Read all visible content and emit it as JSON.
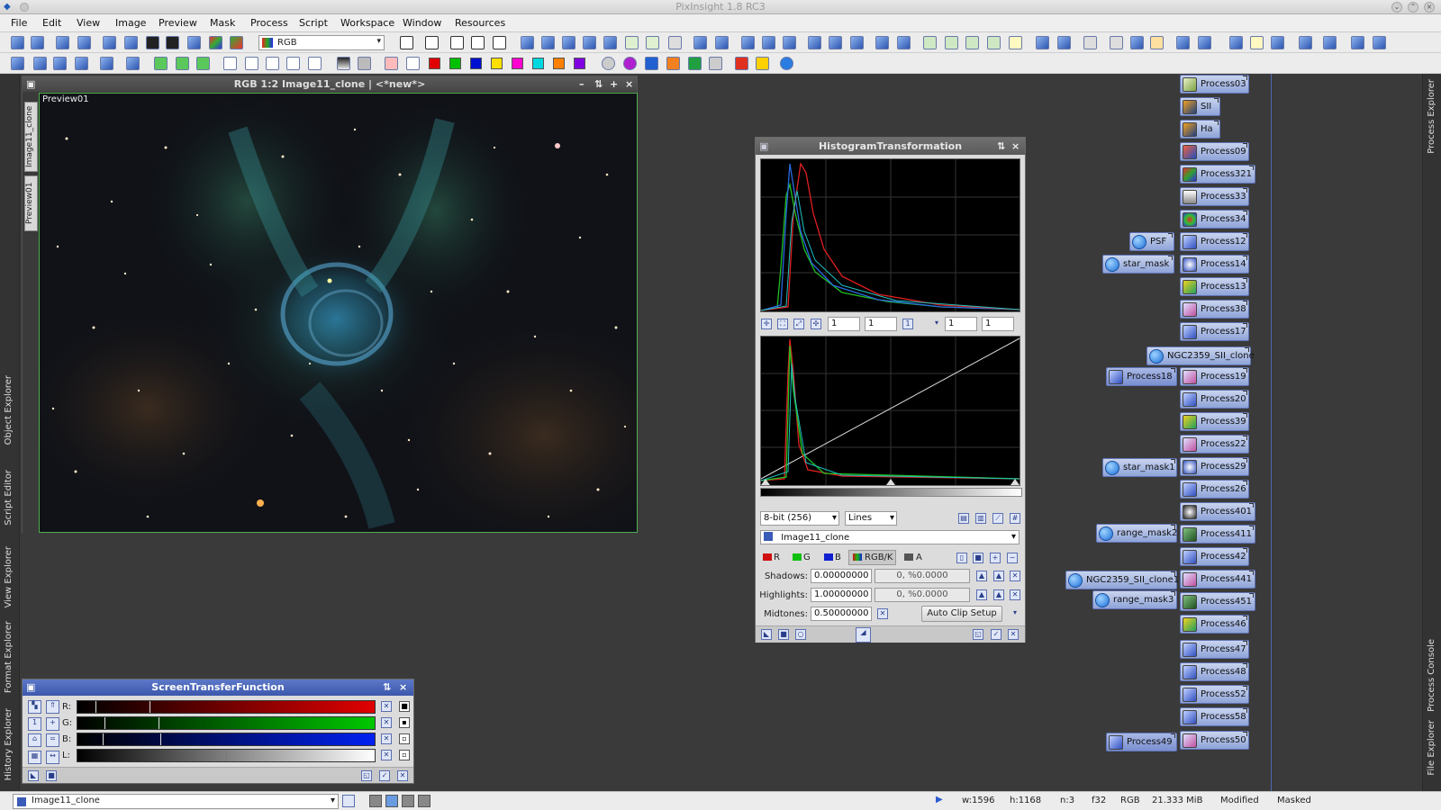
{
  "app": {
    "title": "PixInsight 1.8 RC3"
  },
  "menu": [
    "File",
    "Edit",
    "View",
    "Image",
    "Preview",
    "Mask",
    "Process",
    "Script",
    "Workspace",
    "Window",
    "Resources"
  ],
  "toolbar": {
    "color_space_value": "RGB"
  },
  "left_tabs": [
    "Object Explorer",
    "Script Editor",
    "View Explorer",
    "Format Explorer",
    "History Explorer"
  ],
  "right_tabs": [
    "Process Explorer",
    "Process Console",
    "File Explorer"
  ],
  "image_window": {
    "title": "RGB 1:2 Image11_clone | <*new*>",
    "tabs": [
      "Image11_clone",
      "Preview01"
    ],
    "preview_label": "Preview01"
  },
  "histogram": {
    "title": "HistogramTransformation",
    "zoom": [
      "1",
      "1",
      "1",
      "1"
    ],
    "resolution": "8-bit (256)",
    "graph_style": "Lines",
    "view": "Image11_clone",
    "channels": [
      "R",
      "G",
      "B",
      "RGB/K",
      "A"
    ],
    "shadows_label": "Shadows:",
    "shadows_value": "0.00000000",
    "shadows_clip": "0, %0.0000",
    "highlights_label": "Highlights:",
    "highlights_value": "1.00000000",
    "highlights_clip": "0, %0.0000",
    "midtones_label": "Midtones:",
    "midtones_value": "0.50000000",
    "auto_clip": "Auto Clip Setup"
  },
  "stf": {
    "title": "ScreenTransferFunction",
    "channels": [
      "R:",
      "G:",
      "B:",
      "L:"
    ]
  },
  "process_icons": [
    {
      "label": "Process03"
    },
    {
      "label": "SII"
    },
    {
      "label": "Ha"
    },
    {
      "label": "Process09"
    },
    {
      "label": "Process321"
    },
    {
      "label": "Process33"
    },
    {
      "label": "Process34"
    },
    {
      "label": "PSF"
    },
    {
      "label": "Process12"
    },
    {
      "label": "star_mask"
    },
    {
      "label": "Process14"
    },
    {
      "label": "Process13"
    },
    {
      "label": "Process38"
    },
    {
      "label": "Process17"
    },
    {
      "label": "NGC2359_SII_clone"
    },
    {
      "label": "Process18"
    },
    {
      "label": "Process19"
    },
    {
      "label": "Process20"
    },
    {
      "label": "Process39"
    },
    {
      "label": "Process22"
    },
    {
      "label": "star_mask1"
    },
    {
      "label": "Process29"
    },
    {
      "label": "Process26"
    },
    {
      "label": "Process401"
    },
    {
      "label": "range_mask2"
    },
    {
      "label": "Process411"
    },
    {
      "label": "Process42"
    },
    {
      "label": "NGC2359_SII_clone1"
    },
    {
      "label": "Process441"
    },
    {
      "label": "range_mask3"
    },
    {
      "label": "Process451"
    },
    {
      "label": "Process46"
    },
    {
      "label": "Process47"
    },
    {
      "label": "Process48"
    },
    {
      "label": "Process52"
    },
    {
      "label": "Process58"
    },
    {
      "label": "Process49"
    },
    {
      "label": "Process50"
    }
  ],
  "statusbar": {
    "view": "Image11_clone",
    "width": "w:1596",
    "height": "h:1168",
    "channels": "n:3",
    "format": "f32",
    "color": "RGB",
    "size": "21.333 MiB",
    "modified": "Modified",
    "masked": "Masked"
  }
}
